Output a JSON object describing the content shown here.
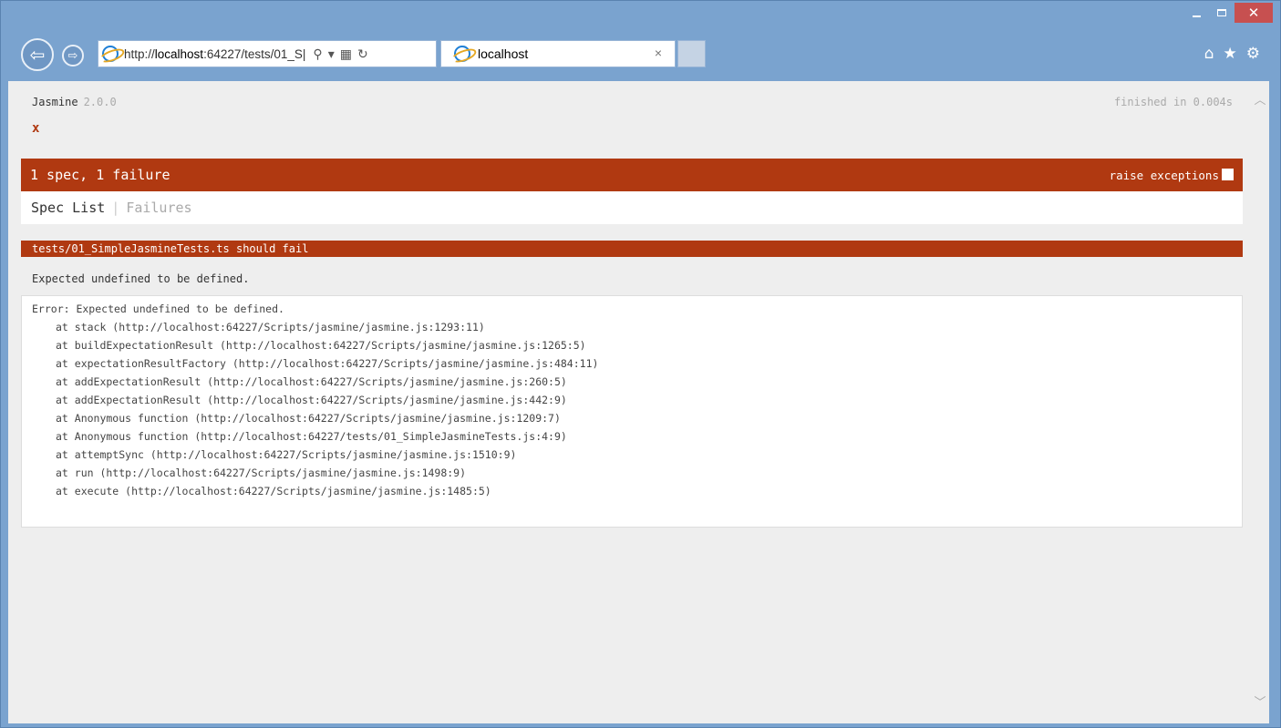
{
  "browser": {
    "address": {
      "prefix": "http://",
      "host": "localhost",
      "rest": ":64227/tests/01_S|"
    },
    "tab": {
      "title": "localhost",
      "close": "×"
    },
    "caption": {
      "close": "✕"
    },
    "toolbar_icons": [
      "home-icon",
      "favorites-star-icon",
      "settings-gear-icon"
    ]
  },
  "jasmine": {
    "title": "Jasmine",
    "version": "2.0.0",
    "duration": "finished in 0.004s",
    "symbol": "x",
    "summary": "1 spec, 1 failure",
    "raise_exceptions_label": "raise exceptions",
    "menu": {
      "spec_list": "Spec List",
      "separator": "|",
      "failures": "Failures"
    },
    "failure": {
      "description": "tests/01_SimpleJasmineTests.ts should fail",
      "message": "Expected undefined to be defined.",
      "stack_header": "Error: Expected undefined to be defined.",
      "stack": [
        "at stack (http://localhost:64227/Scripts/jasmine/jasmine.js:1293:11)",
        "at buildExpectationResult (http://localhost:64227/Scripts/jasmine/jasmine.js:1265:5)",
        "at expectationResultFactory (http://localhost:64227/Scripts/jasmine/jasmine.js:484:11)",
        "at addExpectationResult (http://localhost:64227/Scripts/jasmine/jasmine.js:260:5)",
        "at addExpectationResult (http://localhost:64227/Scripts/jasmine/jasmine.js:442:9)",
        "at Anonymous function (http://localhost:64227/Scripts/jasmine/jasmine.js:1209:7)",
        "at Anonymous function (http://localhost:64227/tests/01_SimpleJasmineTests.js:4:9)",
        "at attemptSync (http://localhost:64227/Scripts/jasmine/jasmine.js:1510:9)",
        "at run (http://localhost:64227/Scripts/jasmine/jasmine.js:1498:9)",
        "at execute (http://localhost:64227/Scripts/jasmine/jasmine.js:1485:5)"
      ]
    }
  },
  "colors": {
    "failure": "#b03911",
    "chrome": "#7aa3cf",
    "page_bg": "#eeeeee"
  }
}
